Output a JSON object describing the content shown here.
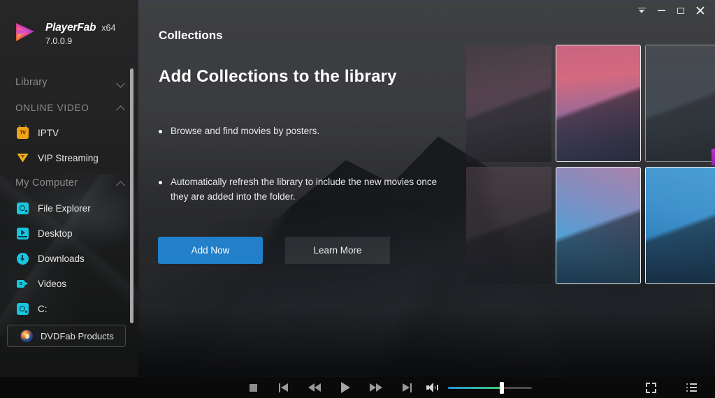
{
  "brand": {
    "name": "PlayerFab",
    "arch": "x64",
    "version": "7.0.0.9",
    "logo_icon": "playerfab-logo-icon"
  },
  "titlebar": {
    "buttons": [
      {
        "name": "tray-icon",
        "label": "Minimize to tray"
      },
      {
        "name": "minimize-icon",
        "label": "Minimize"
      },
      {
        "name": "maximize-icon",
        "label": "Maximize"
      },
      {
        "name": "close-icon",
        "label": "Close"
      }
    ]
  },
  "sidebar": {
    "groups": [
      {
        "label": "Library",
        "state": "collapsed",
        "chevron": "chevron-down-icon"
      },
      {
        "label": "ONLINE VIDEO",
        "state": "expanded",
        "chevron": "chevron-up-icon"
      },
      {
        "label": "My Computer",
        "state": "expanded",
        "chevron": "chevron-up-icon"
      }
    ],
    "online_video_items": [
      {
        "label": "IPTV",
        "icon": "iptv-icon",
        "icon_color": "#f0a218"
      },
      {
        "label": "VIP Streaming",
        "icon": "vip-crown-icon",
        "icon_color": "#f0b21a"
      }
    ],
    "my_computer_items": [
      {
        "label": "File Explorer",
        "icon": "folder-explorer-icon",
        "icon_color": "#17c6e0"
      },
      {
        "label": "Desktop",
        "icon": "desktop-icon",
        "icon_color": "#17c6e0"
      },
      {
        "label": "Downloads",
        "icon": "download-icon",
        "icon_color": "#17c6e0"
      },
      {
        "label": "Videos",
        "icon": "video-camera-icon",
        "icon_color": "#17c6e0"
      },
      {
        "label": "C:",
        "icon": "drive-icon",
        "icon_color": "#17c6e0"
      }
    ],
    "dvdfab_button": {
      "label": "DVDFab Products",
      "icon": "dvdfab-logo-icon"
    },
    "scrollbar": {
      "name": "sidebar-scrollbar"
    }
  },
  "main": {
    "page_title": "Collections",
    "hero_title": "Add Collections to the library",
    "bullets": [
      "Browse and find movies by posters.",
      "Automatically refresh the library to include the new movies once they are added into the folder."
    ],
    "primary_button": {
      "label": "Add Now",
      "color": "#2180c9"
    },
    "secondary_button": {
      "label": "Learn More"
    },
    "poster_grid": {
      "rows": 2,
      "columns": 3,
      "cards": [
        {
          "name": "poster-card-1",
          "highlighted": false,
          "dimmed": true
        },
        {
          "name": "poster-card-2",
          "highlighted": true,
          "dimmed": false
        },
        {
          "name": "poster-card-3",
          "highlighted": true,
          "dimmed": true
        },
        {
          "name": "poster-card-4",
          "highlighted": false,
          "dimmed": true
        },
        {
          "name": "poster-card-5",
          "highlighted": true,
          "dimmed": false
        },
        {
          "name": "poster-card-6",
          "highlighted": true,
          "dimmed": false
        }
      ]
    },
    "side_tab": {
      "name": "right-edge-tab",
      "color": "#c031c9"
    }
  },
  "player": {
    "controls": [
      {
        "name": "stop-button",
        "icon": "stop-icon"
      },
      {
        "name": "previous-button",
        "icon": "skip-previous-icon"
      },
      {
        "name": "rewind-button",
        "icon": "rewind-icon"
      },
      {
        "name": "play-button",
        "icon": "play-icon"
      },
      {
        "name": "fast-forward-button",
        "icon": "fast-forward-icon"
      },
      {
        "name": "next-button",
        "icon": "skip-next-icon"
      }
    ],
    "volume": {
      "icon": "volume-icon",
      "level_percent": 65,
      "fill_start_color": "#2295db",
      "fill_end_color": "#3fcb71"
    },
    "right_controls": [
      {
        "name": "fullscreen-button",
        "icon": "fullscreen-icon"
      },
      {
        "name": "playlist-button",
        "icon": "playlist-icon"
      }
    ]
  }
}
